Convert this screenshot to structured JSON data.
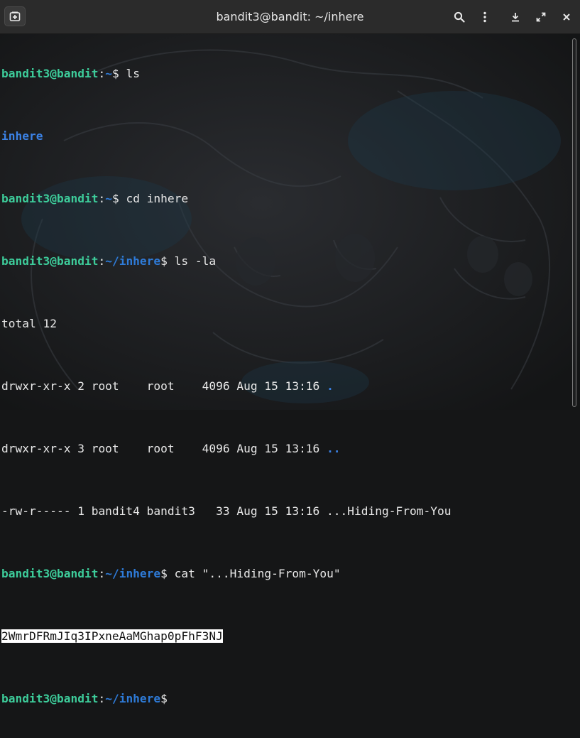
{
  "window": {
    "title": "bandit3@bandit: ~/inhere"
  },
  "terminal": {
    "colors": {
      "user": "#3dcc9a",
      "path": "#2e7bd8",
      "dir": "#3b82e6",
      "text": "#e8e8e8",
      "selection_bg": "#ffffff"
    },
    "lines": [
      {
        "user": "bandit3@bandit",
        "colon": ":",
        "path": "~",
        "suffix": "$ ",
        "cmd": "ls"
      },
      {
        "output_dir": "inhere"
      },
      {
        "user": "bandit3@bandit",
        "colon": ":",
        "path": "~",
        "suffix": "$ ",
        "cmd": "cd inhere"
      },
      {
        "user": "bandit3@bandit",
        "colon": ":",
        "path": "~/inhere",
        "suffix": "$ ",
        "cmd": "ls -la"
      },
      {
        "output": "total 12"
      },
      {
        "output": "drwxr-xr-x 2 root    root    4096 Aug 15 13:16 ",
        "name_dir": "."
      },
      {
        "output": "drwxr-xr-x 3 root    root    4096 Aug 15 13:16 ",
        "name_dir": ".."
      },
      {
        "output": "-rw-r----- 1 bandit4 bandit3   33 Aug 15 13:16 ...Hiding-From-You"
      },
      {
        "user": "bandit3@bandit",
        "colon": ":",
        "path": "~/inhere",
        "suffix": "$ ",
        "cmd": "cat \"...Hiding-From-You\""
      },
      {
        "selected": "2WmrDFRmJIq3IPxneAaMGhap0pFhF3NJ"
      },
      {
        "user": "bandit3@bandit",
        "colon": ":",
        "path": "~/inhere",
        "suffix": "$",
        "cmd": ""
      }
    ]
  },
  "icons": {
    "new_tab": "new-tab-icon",
    "search": "search-icon",
    "menu": "kebab-menu-icon",
    "download": "download-icon",
    "maximize": "maximize-icon",
    "close": "close-icon"
  }
}
